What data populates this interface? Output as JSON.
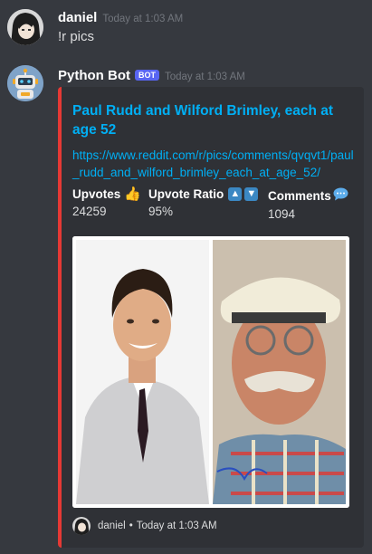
{
  "messages": [
    {
      "author": "daniel",
      "timestamp": "Today at 1:03 AM",
      "content": "!r pics",
      "avatar_icon": "anime-avatar"
    },
    {
      "author": "Python Bot",
      "badge": "BOT",
      "timestamp": "Today at 1:03 AM",
      "avatar_icon": "robot-avatar",
      "embed": {
        "accent_color": "#e53935",
        "title": "Paul Rudd and Wilford Brimley, each at age 52",
        "url": "https://www.reddit.com/r/pics/comments/qvqvt1/paul_rudd_and_wilford_brimley_each_at_age_52/",
        "fields": [
          {
            "name": "Upvotes",
            "value": "24259",
            "icon": "thumbs-up-emoji"
          },
          {
            "name": "Upvote Ratio",
            "value": "95%",
            "icon": "up-down-arrow-emojis"
          },
          {
            "name": "Comments",
            "value": "1094",
            "icon": "speech-balloon-emoji"
          }
        ],
        "image": {
          "alt": "side-by-side photo of two men"
        },
        "footer": {
          "author": "daniel",
          "separator": "•",
          "timestamp": "Today at 1:03 AM"
        }
      }
    }
  ]
}
